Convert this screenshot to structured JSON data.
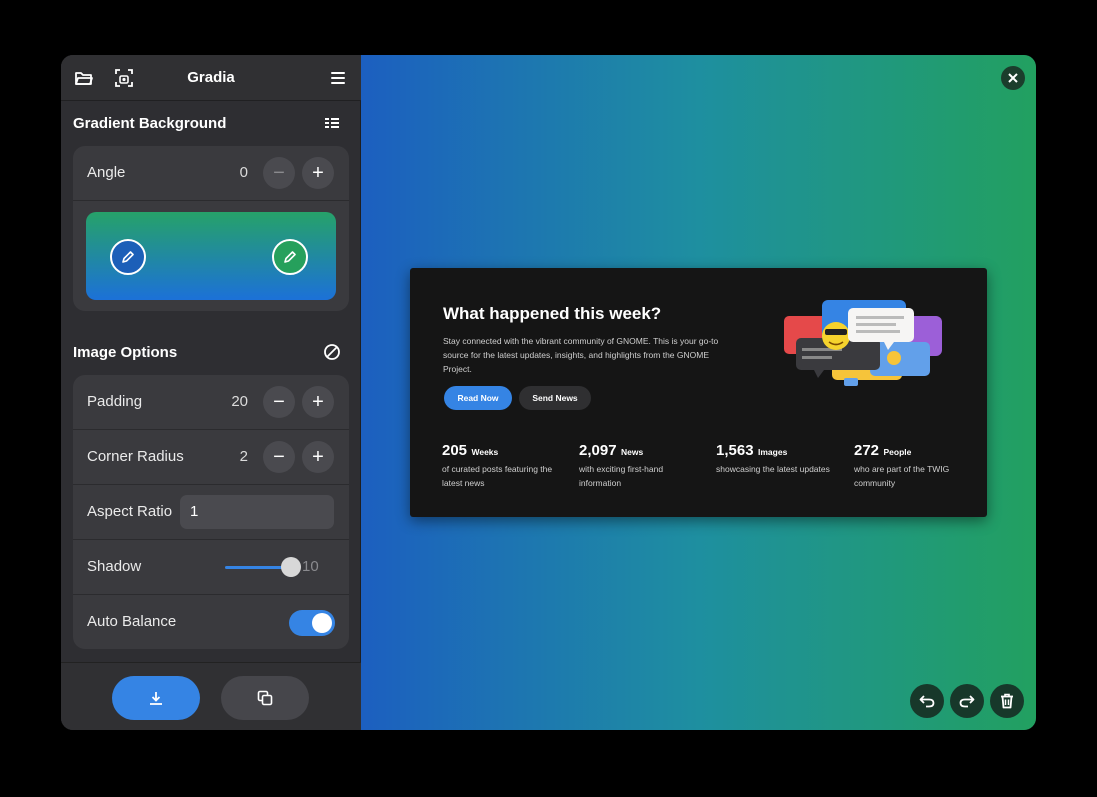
{
  "header": {
    "title": "Gradia"
  },
  "gradient_background": {
    "title": "Gradient Background",
    "angle_label": "Angle",
    "angle_value": "0",
    "start_color": "#1c71d8",
    "end_color": "#26a269"
  },
  "image_options": {
    "title": "Image Options",
    "padding_label": "Padding",
    "padding_value": "20",
    "corner_radius_label": "Corner Radius",
    "corner_radius_value": "2",
    "aspect_ratio_label": "Aspect Ratio",
    "aspect_ratio_value": "1",
    "shadow_label": "Shadow",
    "shadow_value": "10",
    "auto_balance_label": "Auto Balance",
    "auto_balance_on": true
  },
  "colors": {
    "accent": "#3584e4"
  },
  "screenshot": {
    "title": "What happened this week?",
    "description": "Stay connected with the vibrant community of GNOME. This is your go-to source for the latest updates, insights, and highlights from the GNOME Project.",
    "read_now": "Read Now",
    "send_news": "Send News",
    "stats": [
      {
        "number": "205",
        "unit": "Weeks",
        "desc": "of curated posts featuring the latest news"
      },
      {
        "number": "2,097",
        "unit": "News",
        "desc": "with exciting first-hand information"
      },
      {
        "number": "1,563",
        "unit": "Images",
        "desc": "showcasing the latest updates"
      },
      {
        "number": "272",
        "unit": "People",
        "desc": "who are part of the TWIG community"
      }
    ]
  }
}
